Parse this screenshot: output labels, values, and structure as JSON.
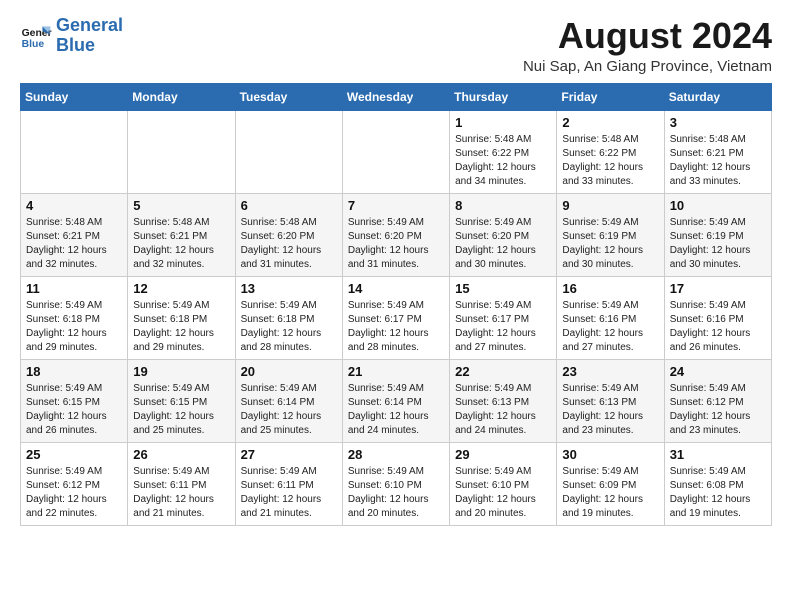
{
  "logo": {
    "line1": "General",
    "line2": "Blue"
  },
  "title": "August 2024",
  "location": "Nui Sap, An Giang Province, Vietnam",
  "days_of_week": [
    "Sunday",
    "Monday",
    "Tuesday",
    "Wednesday",
    "Thursday",
    "Friday",
    "Saturday"
  ],
  "weeks": [
    [
      {
        "day": "",
        "info": ""
      },
      {
        "day": "",
        "info": ""
      },
      {
        "day": "",
        "info": ""
      },
      {
        "day": "",
        "info": ""
      },
      {
        "day": "1",
        "info": "Sunrise: 5:48 AM\nSunset: 6:22 PM\nDaylight: 12 hours\nand 34 minutes."
      },
      {
        "day": "2",
        "info": "Sunrise: 5:48 AM\nSunset: 6:22 PM\nDaylight: 12 hours\nand 33 minutes."
      },
      {
        "day": "3",
        "info": "Sunrise: 5:48 AM\nSunset: 6:21 PM\nDaylight: 12 hours\nand 33 minutes."
      }
    ],
    [
      {
        "day": "4",
        "info": "Sunrise: 5:48 AM\nSunset: 6:21 PM\nDaylight: 12 hours\nand 32 minutes."
      },
      {
        "day": "5",
        "info": "Sunrise: 5:48 AM\nSunset: 6:21 PM\nDaylight: 12 hours\nand 32 minutes."
      },
      {
        "day": "6",
        "info": "Sunrise: 5:48 AM\nSunset: 6:20 PM\nDaylight: 12 hours\nand 31 minutes."
      },
      {
        "day": "7",
        "info": "Sunrise: 5:49 AM\nSunset: 6:20 PM\nDaylight: 12 hours\nand 31 minutes."
      },
      {
        "day": "8",
        "info": "Sunrise: 5:49 AM\nSunset: 6:20 PM\nDaylight: 12 hours\nand 30 minutes."
      },
      {
        "day": "9",
        "info": "Sunrise: 5:49 AM\nSunset: 6:19 PM\nDaylight: 12 hours\nand 30 minutes."
      },
      {
        "day": "10",
        "info": "Sunrise: 5:49 AM\nSunset: 6:19 PM\nDaylight: 12 hours\nand 30 minutes."
      }
    ],
    [
      {
        "day": "11",
        "info": "Sunrise: 5:49 AM\nSunset: 6:18 PM\nDaylight: 12 hours\nand 29 minutes."
      },
      {
        "day": "12",
        "info": "Sunrise: 5:49 AM\nSunset: 6:18 PM\nDaylight: 12 hours\nand 29 minutes."
      },
      {
        "day": "13",
        "info": "Sunrise: 5:49 AM\nSunset: 6:18 PM\nDaylight: 12 hours\nand 28 minutes."
      },
      {
        "day": "14",
        "info": "Sunrise: 5:49 AM\nSunset: 6:17 PM\nDaylight: 12 hours\nand 28 minutes."
      },
      {
        "day": "15",
        "info": "Sunrise: 5:49 AM\nSunset: 6:17 PM\nDaylight: 12 hours\nand 27 minutes."
      },
      {
        "day": "16",
        "info": "Sunrise: 5:49 AM\nSunset: 6:16 PM\nDaylight: 12 hours\nand 27 minutes."
      },
      {
        "day": "17",
        "info": "Sunrise: 5:49 AM\nSunset: 6:16 PM\nDaylight: 12 hours\nand 26 minutes."
      }
    ],
    [
      {
        "day": "18",
        "info": "Sunrise: 5:49 AM\nSunset: 6:15 PM\nDaylight: 12 hours\nand 26 minutes."
      },
      {
        "day": "19",
        "info": "Sunrise: 5:49 AM\nSunset: 6:15 PM\nDaylight: 12 hours\nand 25 minutes."
      },
      {
        "day": "20",
        "info": "Sunrise: 5:49 AM\nSunset: 6:14 PM\nDaylight: 12 hours\nand 25 minutes."
      },
      {
        "day": "21",
        "info": "Sunrise: 5:49 AM\nSunset: 6:14 PM\nDaylight: 12 hours\nand 24 minutes."
      },
      {
        "day": "22",
        "info": "Sunrise: 5:49 AM\nSunset: 6:13 PM\nDaylight: 12 hours\nand 24 minutes."
      },
      {
        "day": "23",
        "info": "Sunrise: 5:49 AM\nSunset: 6:13 PM\nDaylight: 12 hours\nand 23 minutes."
      },
      {
        "day": "24",
        "info": "Sunrise: 5:49 AM\nSunset: 6:12 PM\nDaylight: 12 hours\nand 23 minutes."
      }
    ],
    [
      {
        "day": "25",
        "info": "Sunrise: 5:49 AM\nSunset: 6:12 PM\nDaylight: 12 hours\nand 22 minutes."
      },
      {
        "day": "26",
        "info": "Sunrise: 5:49 AM\nSunset: 6:11 PM\nDaylight: 12 hours\nand 21 minutes."
      },
      {
        "day": "27",
        "info": "Sunrise: 5:49 AM\nSunset: 6:11 PM\nDaylight: 12 hours\nand 21 minutes."
      },
      {
        "day": "28",
        "info": "Sunrise: 5:49 AM\nSunset: 6:10 PM\nDaylight: 12 hours\nand 20 minutes."
      },
      {
        "day": "29",
        "info": "Sunrise: 5:49 AM\nSunset: 6:10 PM\nDaylight: 12 hours\nand 20 minutes."
      },
      {
        "day": "30",
        "info": "Sunrise: 5:49 AM\nSunset: 6:09 PM\nDaylight: 12 hours\nand 19 minutes."
      },
      {
        "day": "31",
        "info": "Sunrise: 5:49 AM\nSunset: 6:08 PM\nDaylight: 12 hours\nand 19 minutes."
      }
    ]
  ]
}
